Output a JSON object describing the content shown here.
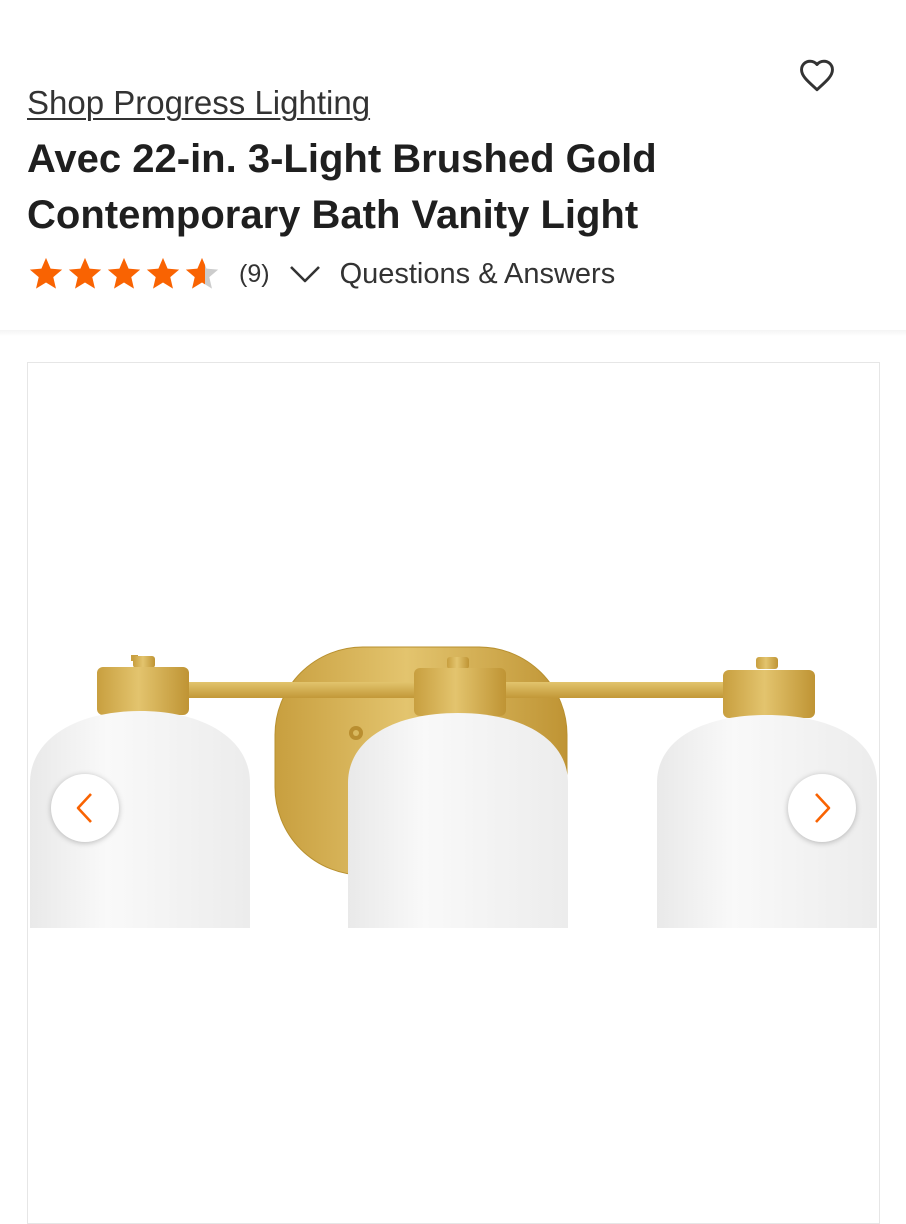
{
  "header": {
    "favorite_icon": "heart-outline-icon"
  },
  "product": {
    "brand_link": "Shop Progress Lighting",
    "title": "Avec 22-in. 3-Light Brushed Gold Contemporary Bath Vanity Light",
    "rating": 4.6,
    "rating_max": 5,
    "review_count": "(9)",
    "reviews_toggle_icon": "chevron-down-icon",
    "qa_link": "Questions & Answers"
  },
  "gallery": {
    "prev_icon": "chevron-left-icon",
    "next_icon": "chevron-right-icon"
  },
  "colors": {
    "star_fill": "#f96302",
    "star_empty": "#cccccc",
    "text": "#333333",
    "title": "#1f1f1f",
    "nav_arrow": "#f96302",
    "brushed_gold": "#d8b45a",
    "shade_white": "#f5f5f5"
  }
}
